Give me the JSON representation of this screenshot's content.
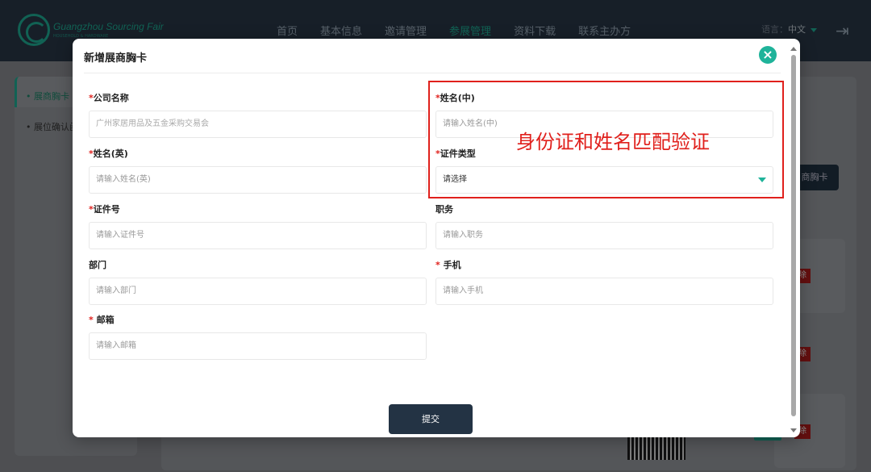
{
  "header": {
    "brand": "Guangzhou Sourcing Fair",
    "brand_sub": "HOUSEHOLD & HARDWARE",
    "nav": [
      "首页",
      "基本信息",
      "邀请管理",
      "参展管理",
      "资料下载",
      "联系主办方"
    ],
    "active_nav": "参展管理",
    "lang_label": "语言：",
    "lang_value": "中文"
  },
  "sidebar": {
    "items": [
      "展商胸卡",
      "展位确认函"
    ]
  },
  "background": {
    "button_fragment": "商胸卡",
    "delete_fragment": "除"
  },
  "modal": {
    "title": "新增展商胸卡",
    "fields": {
      "company": {
        "label": "公司名称",
        "required": "*",
        "value": "广州家居用品及五金采购交易会"
      },
      "name_cn": {
        "label": "姓名(中)",
        "required": "*",
        "placeholder": "请输入姓名(中)"
      },
      "name_en": {
        "label": "姓名(英)",
        "required": "*",
        "placeholder": "请输入姓名(英)"
      },
      "id_type": {
        "label": "证件类型",
        "required": "*",
        "value": "请选择"
      },
      "id_no": {
        "label": "证件号",
        "required": "*",
        "placeholder": "请输入证件号"
      },
      "position": {
        "label": "职务",
        "required": "",
        "placeholder": "请输入职务"
      },
      "dept": {
        "label": "部门",
        "required": "",
        "placeholder": "请输入部门"
      },
      "mobile": {
        "label": " 手机",
        "required": "*",
        "placeholder": "请输入手机"
      },
      "email": {
        "label": " 邮箱",
        "required": "*",
        "placeholder": "请输入邮箱"
      }
    },
    "submit_label": "提交",
    "annotation": "身份证和姓名匹配验证"
  },
  "colors": {
    "accent": "#1fb39a",
    "annotation_red": "#e0201c",
    "dark": "#233344"
  }
}
